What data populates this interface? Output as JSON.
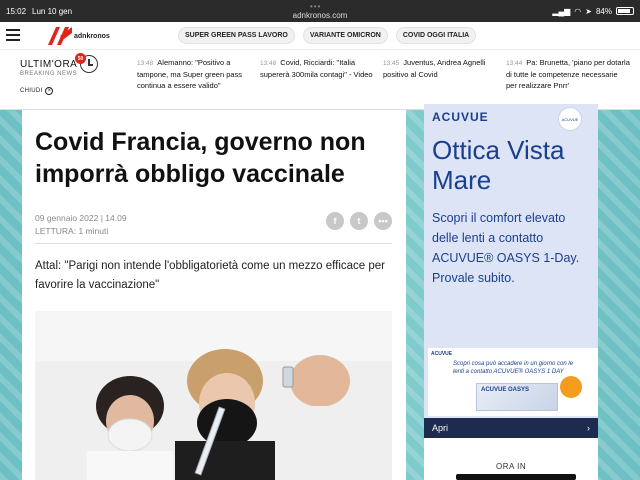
{
  "statusbar": {
    "time": "15:02",
    "date": "Lun 10 gen",
    "url": "adnkronos.com",
    "battery": "84%",
    "battery_level": 0.84
  },
  "nav": {
    "logo_text": "adnkronos",
    "pills": [
      "SUPER GREEN PASS LAVORO",
      "VARIANTE OMICRON",
      "COVID OGGI ITALIA"
    ]
  },
  "breaking": {
    "title": "ULTIM'ORA",
    "subtitle": "BREAKING NEWS",
    "badge": "50",
    "close_label": "CHIUDI",
    "items": [
      {
        "time": "13:48",
        "text": "Alemanno: \"Positivo a tampone, ma Super green pass continua a essere valido\""
      },
      {
        "time": "13:48",
        "text": "Covid, Ricciardi: \"Italia supererà 300mila contagi\" - Video"
      },
      {
        "time": "13:45",
        "text": "Juventus, Andrea Agnelli positivo al Covid"
      },
      {
        "time": "13:44",
        "text": "Pa: Brunetta, 'piano per dotarla di tutte le competenze necessarie per realizzare Pnrr'"
      }
    ]
  },
  "article": {
    "headline": "Covid Francia, governo non imporrà obbligo vaccinale",
    "date": "09 gennaio 2022 | 14.09",
    "reading": "LETTURA: 1 minuti",
    "lead": "Attal: \"Parigi non intende l'obbligatorietà come un mezzo efficace per favorire la vaccinazione\"",
    "share": [
      "f",
      "t",
      "•••"
    ]
  },
  "ad": {
    "brand": "ACUVUE",
    "circle_text": "ACUVUE",
    "title": "Ottica Vista Mare",
    "body": "Scopri il comfort elevato delle lenti a contatto ACUVUE® OASYS 1-Day. Provale subito.",
    "image_brand": "ACUVUE",
    "image_tagline": "Scopri cosa può accadere in un giorno con le lenti a contatto ACUVUE® OASYS 1 DAY",
    "image_box_label": "ACUVUE OASYS",
    "cta": "Apri",
    "cta_arrow": "›"
  },
  "sidebar": {
    "ora_in": "ORA IN"
  }
}
